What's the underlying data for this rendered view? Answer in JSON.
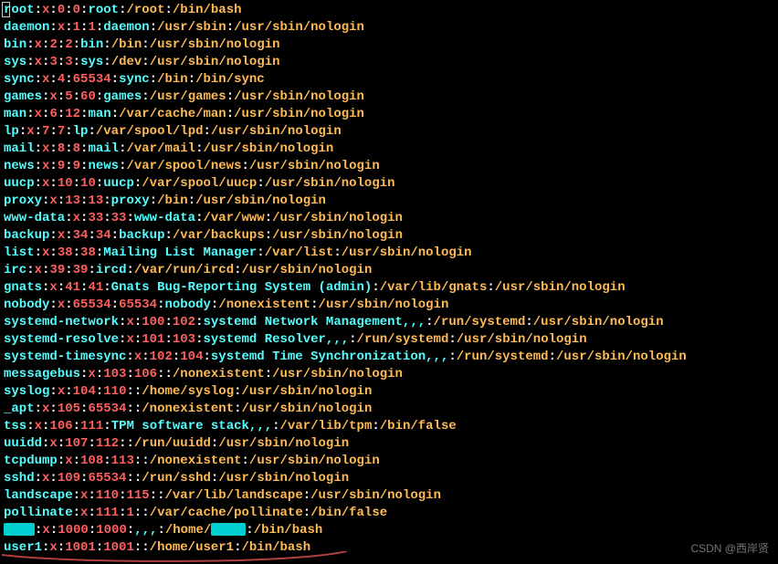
{
  "watermark": "CSDN @西岸贤",
  "entries": [
    {
      "user": "root",
      "x": "x",
      "uid": "0",
      "gid": "0",
      "gecos": "root",
      "home": "/root",
      "shell": "/bin/bash"
    },
    {
      "user": "daemon",
      "x": "x",
      "uid": "1",
      "gid": "1",
      "gecos": "daemon",
      "home": "/usr/sbin",
      "shell": "/usr/sbin/nologin"
    },
    {
      "user": "bin",
      "x": "x",
      "uid": "2",
      "gid": "2",
      "gecos": "bin",
      "home": "/bin",
      "shell": "/usr/sbin/nologin"
    },
    {
      "user": "sys",
      "x": "x",
      "uid": "3",
      "gid": "3",
      "gecos": "sys",
      "home": "/dev",
      "shell": "/usr/sbin/nologin"
    },
    {
      "user": "sync",
      "x": "x",
      "uid": "4",
      "gid": "65534",
      "gecos": "sync",
      "home": "/bin",
      "shell": "/bin/sync"
    },
    {
      "user": "games",
      "x": "x",
      "uid": "5",
      "gid": "60",
      "gecos": "games",
      "home": "/usr/games",
      "shell": "/usr/sbin/nologin"
    },
    {
      "user": "man",
      "x": "x",
      "uid": "6",
      "gid": "12",
      "gecos": "man",
      "home": "/var/cache/man",
      "shell": "/usr/sbin/nologin"
    },
    {
      "user": "lp",
      "x": "x",
      "uid": "7",
      "gid": "7",
      "gecos": "lp",
      "home": "/var/spool/lpd",
      "shell": "/usr/sbin/nologin"
    },
    {
      "user": "mail",
      "x": "x",
      "uid": "8",
      "gid": "8",
      "gecos": "mail",
      "home": "/var/mail",
      "shell": "/usr/sbin/nologin"
    },
    {
      "user": "news",
      "x": "x",
      "uid": "9",
      "gid": "9",
      "gecos": "news",
      "home": "/var/spool/news",
      "shell": "/usr/sbin/nologin"
    },
    {
      "user": "uucp",
      "x": "x",
      "uid": "10",
      "gid": "10",
      "gecos": "uucp",
      "home": "/var/spool/uucp",
      "shell": "/usr/sbin/nologin"
    },
    {
      "user": "proxy",
      "x": "x",
      "uid": "13",
      "gid": "13",
      "gecos": "proxy",
      "home": "/bin",
      "shell": "/usr/sbin/nologin"
    },
    {
      "user": "www-data",
      "x": "x",
      "uid": "33",
      "gid": "33",
      "gecos": "www-data",
      "home": "/var/www",
      "shell": "/usr/sbin/nologin"
    },
    {
      "user": "backup",
      "x": "x",
      "uid": "34",
      "gid": "34",
      "gecos": "backup",
      "home": "/var/backups",
      "shell": "/usr/sbin/nologin"
    },
    {
      "user": "list",
      "x": "x",
      "uid": "38",
      "gid": "38",
      "gecos": "Mailing List Manager",
      "home": "/var/list",
      "shell": "/usr/sbin/nologin"
    },
    {
      "user": "irc",
      "x": "x",
      "uid": "39",
      "gid": "39",
      "gecos": "ircd",
      "home": "/var/run/ircd",
      "shell": "/usr/sbin/nologin"
    },
    {
      "user": "gnats",
      "x": "x",
      "uid": "41",
      "gid": "41",
      "gecos": "Gnats Bug-Reporting System (admin)",
      "home": "/var/lib/gnats",
      "shell": "/usr/sbin/nologin"
    },
    {
      "user": "nobody",
      "x": "x",
      "uid": "65534",
      "gid": "65534",
      "gecos": "nobody",
      "home": "/nonexistent",
      "shell": "/usr/sbin/nologin"
    },
    {
      "user": "systemd-network",
      "x": "x",
      "uid": "100",
      "gid": "102",
      "gecos": "systemd Network Management,,,",
      "home": "/run/systemd",
      "shell": "/usr/sbin/nologin"
    },
    {
      "user": "systemd-resolve",
      "x": "x",
      "uid": "101",
      "gid": "103",
      "gecos": "systemd Resolver,,,",
      "home": "/run/systemd",
      "shell": "/usr/sbin/nologin"
    },
    {
      "user": "systemd-timesync",
      "x": "x",
      "uid": "102",
      "gid": "104",
      "gecos": "systemd Time Synchronization,,,",
      "home": "/run/systemd",
      "shell": "/usr/sbin/nologin"
    },
    {
      "user": "messagebus",
      "x": "x",
      "uid": "103",
      "gid": "106",
      "gecos": "",
      "home": "/nonexistent",
      "shell": "/usr/sbin/nologin"
    },
    {
      "user": "syslog",
      "x": "x",
      "uid": "104",
      "gid": "110",
      "gecos": "",
      "home": "/home/syslog",
      "shell": "/usr/sbin/nologin"
    },
    {
      "user": "_apt",
      "x": "x",
      "uid": "105",
      "gid": "65534",
      "gecos": "",
      "home": "/nonexistent",
      "shell": "/usr/sbin/nologin"
    },
    {
      "user": "tss",
      "x": "x",
      "uid": "106",
      "gid": "111",
      "gecos": "TPM software stack,,,",
      "home": "/var/lib/tpm",
      "shell": "/bin/false"
    },
    {
      "user": "uuidd",
      "x": "x",
      "uid": "107",
      "gid": "112",
      "gecos": "",
      "home": "/run/uuidd",
      "shell": "/usr/sbin/nologin"
    },
    {
      "user": "tcpdump",
      "x": "x",
      "uid": "108",
      "gid": "113",
      "gecos": "",
      "home": "/nonexistent",
      "shell": "/usr/sbin/nologin"
    },
    {
      "user": "sshd",
      "x": "x",
      "uid": "109",
      "gid": "65534",
      "gecos": "",
      "home": "/run/sshd",
      "shell": "/usr/sbin/nologin"
    },
    {
      "user": "landscape",
      "x": "x",
      "uid": "110",
      "gid": "115",
      "gecos": "",
      "home": "/var/lib/landscape",
      "shell": "/usr/sbin/nologin"
    },
    {
      "user": "pollinate",
      "x": "x",
      "uid": "111",
      "gid": "1",
      "gecos": "",
      "home": "/var/cache/pollinate",
      "shell": "/bin/false"
    },
    {
      "user": "[REDACT]",
      "x": "x",
      "uid": "1000",
      "gid": "1000",
      "gecos": ",,,",
      "home": "/home/[REDACT]",
      "shell": "/bin/bash",
      "redacted": true
    },
    {
      "user": "user1",
      "x": "x",
      "uid": "1001",
      "gid": "1001",
      "gecos": "",
      "home": "/home/user1",
      "shell": "/bin/bash"
    }
  ]
}
